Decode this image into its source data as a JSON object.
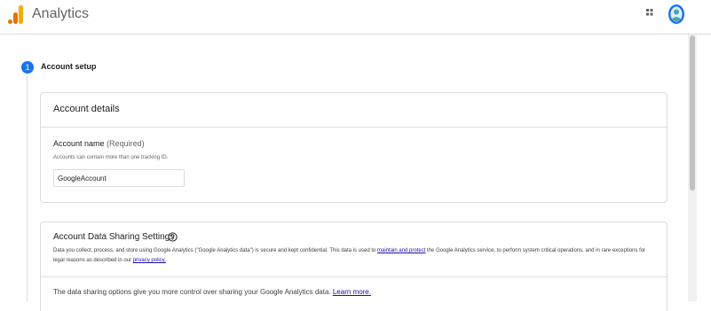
{
  "header": {
    "app_title": "Analytics",
    "logo_icon": "google-analytics-logo-icon",
    "apps_icon": "apps-grid-icon",
    "avatar_icon": "user-avatar-icon"
  },
  "stepper": {
    "step_number": "1",
    "step_label": "Account setup"
  },
  "account_details": {
    "title": "Account details",
    "account_name_label": "Account name",
    "account_name_required": "(Required)",
    "account_name_hint": "Accounts can contain more than one tracking ID.",
    "account_name_value": "GoogleAccount"
  },
  "data_sharing": {
    "title": "Account Data Sharing Settings",
    "help_icon": "help-circle-icon",
    "desc_part1": "Data you collect, process, and store using Google Analytics (\"Google Analytics data\") is secure and kept confidential. This data is used to ",
    "desc_link1": "maintain and protect",
    "desc_part2": " the Google Analytics service, to perform system critical operations, and in rare exceptions for legal reasons as described in our ",
    "desc_link2": "privacy policy.",
    "options_text": "The data sharing options give you more control over sharing your Google Analytics data. ",
    "learn_more": "Learn more."
  },
  "colors": {
    "accent": "#1a73e8",
    "link": "#1a0dab",
    "border": "#dadce0"
  }
}
